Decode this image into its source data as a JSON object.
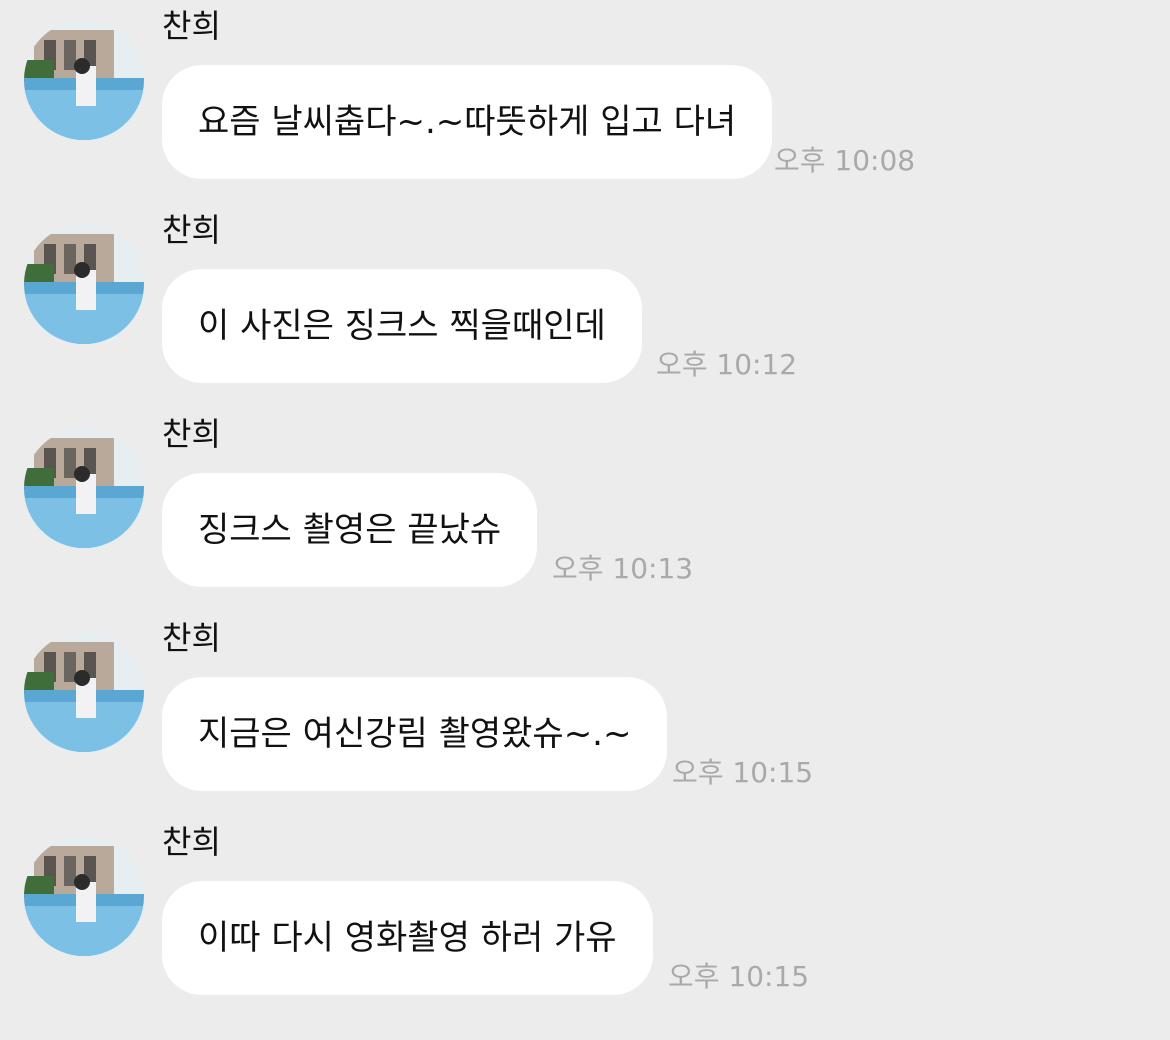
{
  "messages": [
    {
      "sender": "찬희",
      "text": "요즘 날씨춥다~.~따뜻하게 입고 다녀",
      "time": "오후 10:08"
    },
    {
      "sender": "찬희",
      "text": "이 사진은 징크스 찍을때인데",
      "time": "오후 10:12"
    },
    {
      "sender": "찬희",
      "text": "징크스 촬영은 끝났슈",
      "time": "오후 10:13"
    },
    {
      "sender": "찬희",
      "text": "지금은 여신강림 촬영왔슈~.~",
      "time": "오후 10:15"
    },
    {
      "sender": "찬희",
      "text": "이따 다시 영화촬영 하러 가유",
      "time": "오후 10:15"
    }
  ],
  "colors": {
    "background": "#ececec",
    "bubble": "#ffffff",
    "time": "#a9a9a9",
    "pool": "#5aa7d4"
  },
  "icons": {
    "avatar": "profile-photo-pool"
  }
}
